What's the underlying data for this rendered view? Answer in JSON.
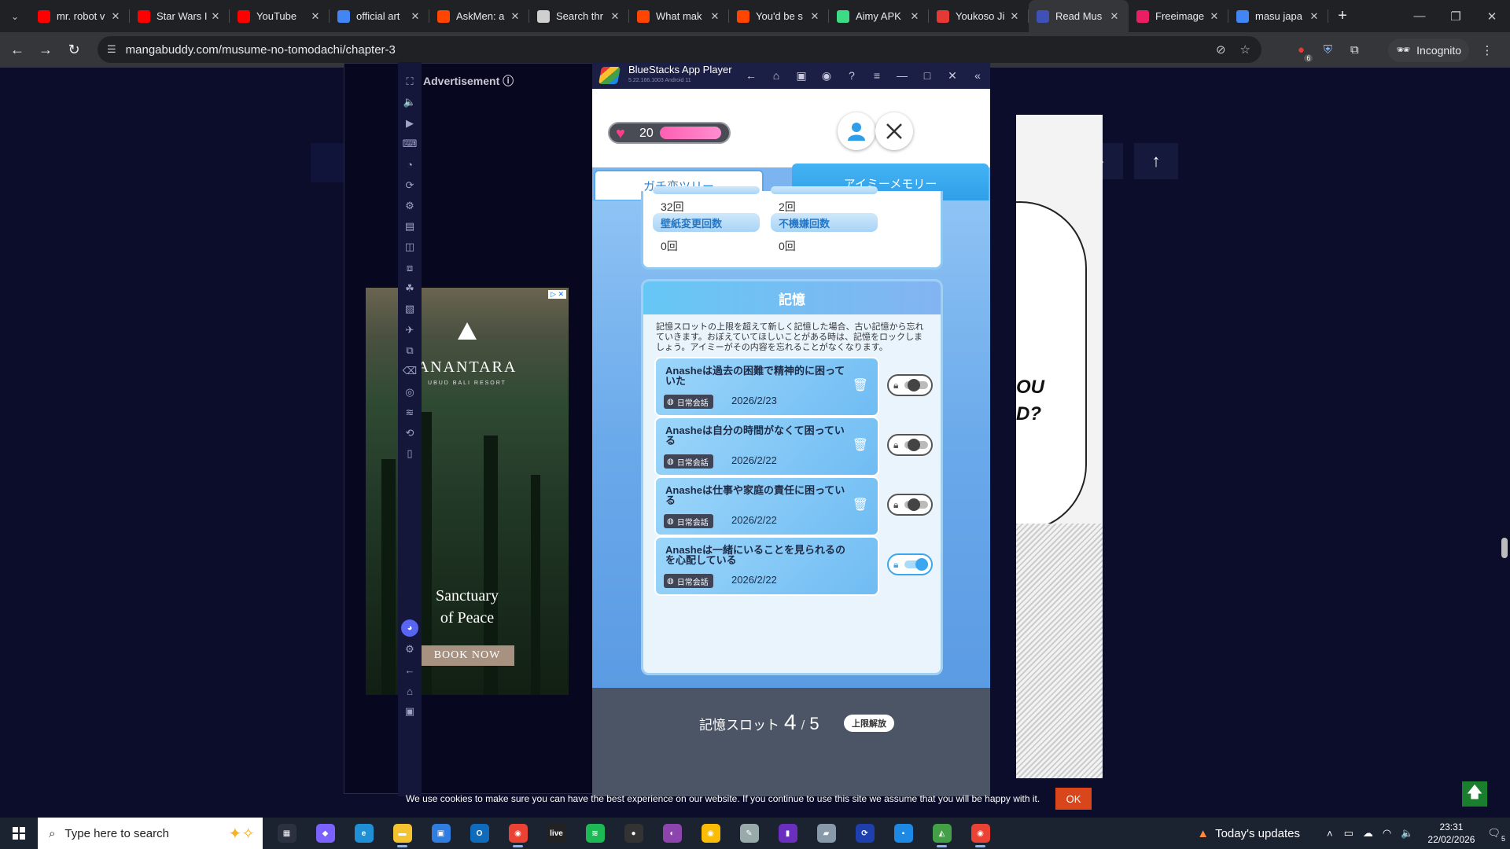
{
  "browser": {
    "tabs": [
      {
        "label": "mr. robot v",
        "icon": "youtube-icon",
        "color": "#ff0000"
      },
      {
        "label": "Star Wars I",
        "icon": "youtube-icon",
        "color": "#ff0000"
      },
      {
        "label": "YouTube",
        "icon": "youtube-icon",
        "color": "#ff0000"
      },
      {
        "label": "official art",
        "icon": "google-icon",
        "color": "#4285f4"
      },
      {
        "label": "AskMen: a",
        "icon": "reddit-icon",
        "color": "#ff4500"
      },
      {
        "label": "Search thr",
        "icon": "shield-icon",
        "color": "#cfcfcf"
      },
      {
        "label": "What mak",
        "icon": "reddit-icon",
        "color": "#ff4500"
      },
      {
        "label": "You'd be s",
        "icon": "reddit-icon",
        "color": "#ff4500"
      },
      {
        "label": "Aimy APK",
        "icon": "apk-icon",
        "color": "#3ddc84"
      },
      {
        "label": "Youkoso Ji",
        "icon": "site-icon",
        "color": "#e53935"
      },
      {
        "label": "Read Mus",
        "icon": "manga-icon",
        "color": "#3f51b5"
      },
      {
        "label": "Freeimage",
        "icon": "image-icon",
        "color": "#e91e63"
      },
      {
        "label": "masu japa",
        "icon": "google-icon",
        "color": "#4285f4"
      }
    ],
    "active_tab_index": 10,
    "url": "mangabuddy.com/musume-no-tomodachi/chapter-3",
    "incognito_label": "Incognito",
    "extension_badge": "6"
  },
  "page": {
    "advertisement_label": "Advertisement ⓘ",
    "ad": {
      "brand": "ANANTARA",
      "sub": "UBUD BALI RESORT",
      "headline_line1": "Sanctuary",
      "headline_line2": "of Peace",
      "cta": "BOOK NOW"
    },
    "manga_text": "OU\nD?",
    "cookie_text": "We use cookies to make sure you can have the best experience on our website. If you continue to use this site we assume that you will be happy with it.",
    "cookie_ok": "OK"
  },
  "bluestacks": {
    "title": "BlueStacks App Player",
    "version": "5.22.166.1003  Android 11"
  },
  "game": {
    "hearts": "20",
    "tabs": {
      "tree": "ガチ恋ツリー",
      "memory": "アイミーメモリー"
    },
    "stats": [
      {
        "value": "32回"
      },
      {
        "value": "2回"
      },
      {
        "label": "壁紙変更回数",
        "value": "0回"
      },
      {
        "label": "不機嫌回数",
        "value": "0回"
      }
    ],
    "memory_header": "記憶",
    "memory_desc": "記憶スロットの上限を超えて新しく記憶した場合、古い記憶から忘れていきます。おぼえていてほしいことがある時は、記憶をロックしましょう。アイミーがその内容を忘れることがなくなります。",
    "memories": [
      {
        "title": "Anasheは過去の困難で精神的に困っていた",
        "category": "日常会話",
        "date": "2026/2/23",
        "locked": false
      },
      {
        "title": "Anasheは自分の時間がなくて困っている",
        "category": "日常会話",
        "date": "2026/2/22",
        "locked": false
      },
      {
        "title": "Anasheは仕事や家庭の責任に困っている",
        "category": "日常会話",
        "date": "2026/2/22",
        "locked": false
      },
      {
        "title": "Anasheは一緒にいることを見られるのを心配している",
        "category": "日常会話",
        "date": "2026/2/22",
        "locked": true
      }
    ],
    "slot_label": "記憶スロット",
    "slot_used": "4",
    "slot_sep": "/",
    "slot_max": "5",
    "unlock_label": "上限解放"
  },
  "taskbar": {
    "search_placeholder": "Type here to search",
    "weather_label": "Today's updates",
    "time": "23:31",
    "date": "22/02/2026",
    "notification_count": "5"
  }
}
